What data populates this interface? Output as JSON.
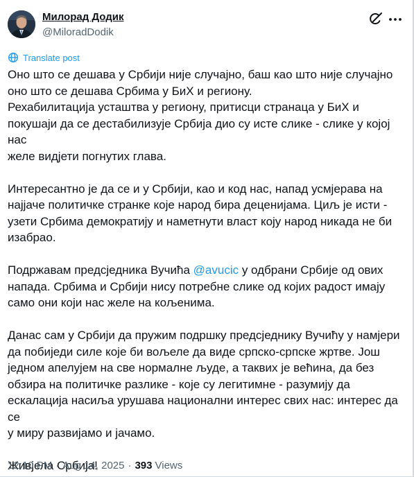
{
  "author": {
    "name": "Милорад Додик",
    "handle": "@MiloradDodik"
  },
  "translate_label": "Translate post",
  "post": {
    "p1": [
      "Оно што се дешава у Србији није случајно, баш као што није случајно",
      "оно што се дешава Србима у БиХ и региону.",
      "Рехабилитација усташтва у региону, притисци странаца у БиХ и",
      "покушаји да се дестабилизује Србија дио су исте слике - слике у којој нас",
      "желе видјети погнутих глава."
    ],
    "p2": [
      "Интересантно је да се и у Србији, као и код нас, напад усмјерава на",
      "најјаче политичке странке које народ бира деценијама. Циљ је исти -",
      "узети Србима демократију и наметнути власт коју народ никада не би",
      "изабрао."
    ],
    "p3_line1_before": "Подржавам предсједника Вучића ",
    "p3_mention": "@avucic",
    "p3_line1_after": " у одбрани Србије од ових",
    "p3_rest": [
      "напада. Србима и Србији нису потребне слике од којих радост имају",
      "само они који нас желе на кољенима."
    ],
    "p4": [
      "Данас сам у Србији да пружим подршку предсједнику Вучићу у намјери",
      "да побиједи силе које би вољеле да виде српско-српске жртве. Још",
      "једном апелујем на све нормалне људе, а таквих је већина, да без",
      "обзира на политичке разлике - које су легитимне - разумију да",
      "ескалација насиља урушава национални интерес свих нас: интерес да се",
      "у миру развијамо и јачамо."
    ],
    "p5": "Живјела Србија!"
  },
  "meta": {
    "time": "12:10 PM",
    "separator": "·",
    "date": "Aug 14, 2025",
    "views_count": "393",
    "views_label": "Views"
  },
  "icons": {
    "grok": "grok-icon",
    "more": "more-icon",
    "translate": "globe-icon"
  }
}
